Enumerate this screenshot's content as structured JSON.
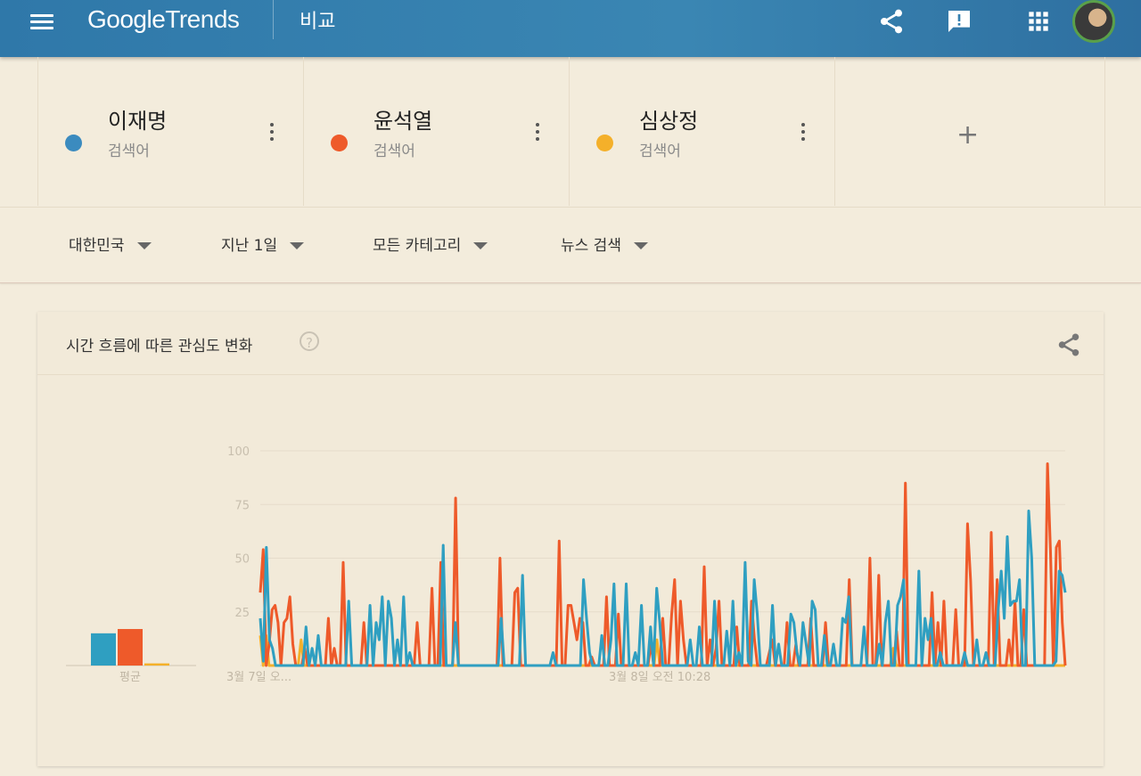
{
  "header": {
    "brand_google": "Google",
    "brand_trends": "Trends",
    "page_title": "비교",
    "icons": [
      "menu-icon",
      "share-icon",
      "feedback-icon",
      "apps-icon",
      "avatar"
    ]
  },
  "terms": [
    {
      "name": "이재명",
      "type": "검색어",
      "color": "#3b8bbf"
    },
    {
      "name": "윤석열",
      "type": "검색어",
      "color": "#ee5a2a"
    },
    {
      "name": "심상정",
      "type": "검색어",
      "color": "#f4b02a"
    }
  ],
  "add_term_label": "+",
  "filters": {
    "region": "대한민국",
    "time": "지난 1일",
    "category": "모든 카테고리",
    "search_type": "뉴스 검색"
  },
  "panel": {
    "title": "시간 흐름에 따른 관심도 변화",
    "help": "?",
    "average_label": "평균"
  },
  "chart_data": {
    "type": "line",
    "title": "시간 흐름에 따른 관심도 변화",
    "xlabel": "",
    "ylabel": "",
    "ylim": [
      0,
      100
    ],
    "yticks": [
      100,
      75,
      50,
      25
    ],
    "x_tick_labels": [
      "3월 7일 오...",
      "3월 8일 오전 10:28"
    ],
    "grid": true,
    "series": [
      {
        "name": "이재명",
        "color": "#2f9fc1",
        "values": [
          22,
          2,
          55,
          12,
          8,
          0,
          0,
          0,
          0,
          0,
          0,
          0,
          0,
          0,
          0,
          18,
          0,
          8,
          0,
          14,
          0,
          0,
          0,
          0,
          0,
          0,
          0,
          0,
          0,
          30,
          0,
          0,
          0,
          0,
          0,
          0,
          28,
          0,
          20,
          12,
          32,
          0,
          30,
          22,
          0,
          12,
          0,
          32,
          0,
          6,
          0,
          0,
          0,
          0,
          0,
          0,
          0,
          0,
          0,
          0,
          56,
          0,
          0,
          0,
          20,
          0,
          0,
          0,
          0,
          0,
          0,
          0,
          0,
          0,
          0,
          0,
          0,
          0,
          0,
          22,
          0,
          0,
          0,
          0,
          0,
          0,
          42,
          0,
          0,
          0,
          0,
          0,
          0,
          0,
          0,
          0,
          6,
          0,
          0,
          0,
          0,
          0,
          0,
          0,
          0,
          0,
          40,
          22,
          6,
          0,
          0,
          0,
          14,
          0,
          0,
          12,
          38,
          0,
          0,
          0,
          38,
          0,
          0,
          6,
          0,
          28,
          0,
          0,
          18,
          0,
          36,
          20,
          0,
          0,
          0,
          0,
          0,
          0,
          0,
          0,
          0,
          12,
          0,
          0,
          18,
          0,
          0,
          0,
          0,
          30,
          0,
          0,
          0,
          16,
          0,
          30,
          0,
          6,
          0,
          48,
          2,
          0,
          40,
          24,
          0,
          0,
          0,
          0,
          28,
          0,
          10,
          0,
          0,
          0,
          24,
          20,
          6,
          0,
          20,
          10,
          0,
          30,
          26,
          0,
          0,
          14,
          0,
          0,
          10,
          0,
          0,
          22,
          20,
          32,
          0,
          0,
          0,
          0,
          18,
          0,
          0,
          0,
          0,
          10,
          0,
          20,
          30,
          0,
          0,
          28,
          32,
          40,
          0,
          0,
          0,
          0,
          44,
          0,
          22,
          12,
          22,
          0,
          0,
          6,
          0,
          0,
          0,
          0,
          0,
          0,
          0,
          6,
          0,
          0,
          0,
          12,
          0,
          0,
          6,
          0,
          0,
          0,
          26,
          44,
          22,
          60,
          28,
          30,
          30,
          40,
          0,
          0,
          72,
          50,
          0,
          0,
          0,
          0,
          0,
          0,
          0,
          2,
          44,
          42,
          34
        ]
      },
      {
        "name": "윤석열",
        "color": "#ee5a2a",
        "values": [
          34,
          54,
          0,
          10,
          26,
          28,
          20,
          0,
          20,
          22,
          32,
          10,
          0,
          0,
          0,
          8,
          0,
          0,
          0,
          0,
          0,
          0,
          0,
          22,
          0,
          8,
          0,
          0,
          48,
          0,
          0,
          0,
          0,
          0,
          0,
          20,
          0,
          0,
          0,
          0,
          0,
          0,
          0,
          0,
          0,
          0,
          0,
          0,
          0,
          0,
          0,
          0,
          0,
          20,
          0,
          0,
          0,
          0,
          36,
          0,
          0,
          48,
          0,
          0,
          0,
          0,
          78,
          0,
          0,
          0,
          0,
          0,
          0,
          0,
          0,
          0,
          0,
          0,
          0,
          0,
          0,
          50,
          0,
          0,
          0,
          0,
          34,
          36,
          0,
          0,
          0,
          0,
          0,
          0,
          0,
          0,
          0,
          0,
          0,
          0,
          0,
          58,
          0,
          0,
          28,
          28,
          20,
          12,
          22,
          20,
          0,
          0,
          4,
          0,
          0,
          0,
          0,
          32,
          0,
          0,
          0,
          24,
          0,
          0,
          0,
          0,
          0,
          0,
          0,
          0,
          0,
          0,
          10,
          0,
          0,
          0,
          22,
          0,
          0,
          24,
          40,
          0,
          30,
          12,
          0,
          0,
          0,
          0,
          0,
          0,
          46,
          0,
          12,
          0,
          8,
          30,
          0,
          0,
          0,
          0,
          0,
          18,
          0,
          0,
          0,
          0,
          30,
          12,
          0,
          0,
          0,
          0,
          6,
          12,
          0,
          0,
          0,
          0,
          20,
          0,
          0,
          10,
          0,
          0,
          0,
          0,
          22,
          0,
          0,
          0,
          0,
          20,
          0,
          0,
          0,
          0,
          0,
          0,
          0,
          40,
          0,
          0,
          0,
          0,
          0,
          0,
          50,
          0,
          0,
          42,
          0,
          0,
          0,
          0,
          0,
          16,
          0,
          0,
          85,
          0,
          0,
          0,
          0,
          0,
          0,
          0,
          0,
          34,
          0,
          20,
          0,
          30,
          0,
          0,
          0,
          26,
          0,
          0,
          0,
          66,
          40,
          0,
          0,
          0,
          0,
          0,
          0,
          62,
          0,
          40,
          0,
          0,
          0,
          12,
          0,
          30,
          0,
          0,
          26,
          0,
          0,
          0,
          0,
          0,
          0,
          0,
          94,
          54,
          0,
          55,
          58,
          20,
          0
        ]
      },
      {
        "name": "심상정",
        "color": "#f4b02a",
        "values": [
          14,
          0,
          14,
          0,
          0,
          0,
          0,
          0,
          0,
          0,
          0,
          0,
          0,
          0,
          12,
          0,
          0,
          0,
          0,
          0,
          0,
          0,
          0,
          0,
          0,
          0,
          0,
          0,
          0,
          0,
          0,
          0,
          0,
          0,
          0,
          0,
          0,
          0,
          0,
          0,
          0,
          0,
          0,
          0,
          0,
          0,
          0,
          0,
          0,
          0,
          0,
          0,
          0,
          0,
          0,
          0,
          0,
          0,
          0,
          0,
          0,
          0,
          0,
          0,
          0,
          0,
          0,
          0,
          0,
          0,
          0,
          0,
          0,
          0,
          0,
          0,
          0,
          0,
          0,
          0,
          0,
          0,
          0,
          0,
          0,
          0,
          0,
          0,
          0,
          0,
          0,
          0,
          0,
          0,
          0,
          0,
          0,
          0,
          0,
          0,
          0,
          0,
          0,
          0,
          0,
          0,
          0,
          0,
          0,
          0,
          0,
          0,
          0,
          0,
          0,
          0,
          0,
          0,
          0,
          0,
          0,
          0,
          0,
          0,
          0,
          0,
          0,
          0,
          0,
          0,
          0,
          0,
          0,
          0,
          0,
          0,
          12,
          0,
          0,
          0,
          0,
          0,
          0,
          0,
          0,
          0,
          0,
          0,
          0,
          0,
          0,
          0,
          0,
          0,
          0,
          0,
          0,
          0,
          0,
          0,
          0,
          0,
          0,
          0,
          0,
          0,
          0,
          0,
          0,
          0,
          0,
          0,
          0,
          0,
          0,
          0,
          0,
          0,
          0,
          0,
          0,
          0,
          0,
          0,
          0,
          0,
          0,
          0,
          0,
          0,
          0,
          0,
          0,
          0,
          0,
          0,
          0,
          0,
          0,
          0,
          0,
          0,
          0,
          0,
          0,
          0,
          0,
          0,
          0,
          0,
          0,
          0,
          0,
          0,
          0,
          0,
          0,
          8,
          0,
          0,
          0,
          0,
          0,
          0,
          0,
          0,
          0,
          0,
          0,
          0,
          0,
          0,
          0,
          0,
          0,
          0,
          0,
          0,
          0,
          0,
          0,
          0,
          0,
          0,
          0,
          0,
          0,
          0,
          0,
          0,
          0,
          0,
          0,
          0,
          0,
          0,
          0,
          0,
          0,
          0,
          0,
          0,
          0,
          0,
          0,
          0,
          0,
          0,
          0,
          0,
          0,
          0,
          0,
          0,
          0,
          0,
          0
        ]
      }
    ],
    "averages": [
      {
        "name": "이재명",
        "value": 15,
        "color": "#2f9fc1"
      },
      {
        "name": "윤석열",
        "value": 17,
        "color": "#ee5a2a"
      },
      {
        "name": "심상정",
        "value": 1,
        "color": "#f4b02a"
      }
    ]
  }
}
